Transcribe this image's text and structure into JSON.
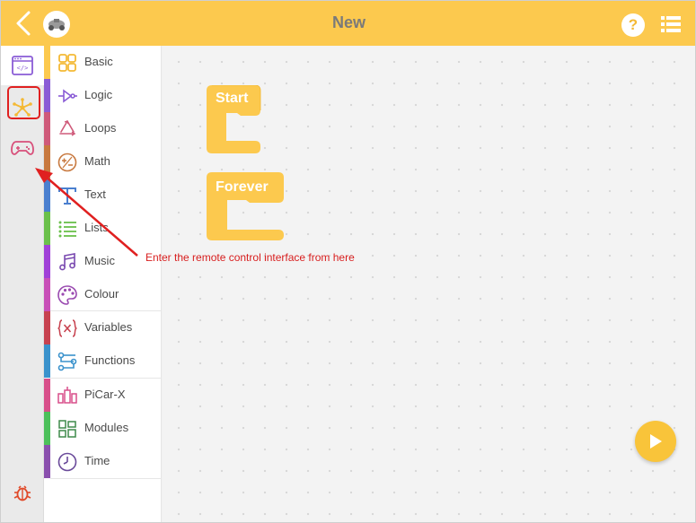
{
  "header": {
    "title": "New",
    "help_label": "?",
    "accent_color": "#fcc94e"
  },
  "rail": {
    "items": [
      {
        "icon": "code-window-icon",
        "active": true
      },
      {
        "icon": "device-hub-icon",
        "active": false
      },
      {
        "icon": "gamepad-icon",
        "active": false,
        "highlighted": true
      },
      {
        "icon": "bug-icon",
        "active": false
      }
    ]
  },
  "categories": [
    {
      "label": "Basic",
      "color": "#fcc94e",
      "icon": "grid-icon"
    },
    {
      "label": "Logic",
      "color": "#8a5cd6",
      "icon": "logic-gate-icon"
    },
    {
      "label": "Loops",
      "color": "#cf5a7a",
      "icon": "recycle-loop-icon"
    },
    {
      "label": "Math",
      "color": "#c8793f",
      "icon": "plus-minus-icon"
    },
    {
      "label": "Text",
      "color": "#4a7fcf",
      "icon": "text-t-icon"
    },
    {
      "label": "Lists",
      "color": "#6ac04a",
      "icon": "list-icon"
    },
    {
      "label": "Music",
      "color": "#a040d8",
      "icon": "music-note-icon"
    },
    {
      "label": "Colour",
      "color": "#c84fb8",
      "icon": "palette-icon"
    },
    {
      "label": "Variables",
      "color": "#c7424f",
      "icon": "variable-x-icon"
    },
    {
      "label": "Functions",
      "color": "#3a92cc",
      "icon": "function-flow-icon"
    },
    {
      "label": "PiCar-X",
      "color": "#d84f8a",
      "icon": "picar-icon"
    },
    {
      "label": "Modules",
      "color": "#4cc05a",
      "icon": "modules-grid-icon"
    },
    {
      "label": "Time",
      "color": "#8a4fae",
      "icon": "clock-icon"
    }
  ],
  "workspace": {
    "blocks": [
      {
        "label": "Start"
      },
      {
        "label": "Forever"
      }
    ],
    "block_color": "#fcc94e"
  },
  "annotation": {
    "text": "Enter the remote control interface from here",
    "color": "#d81e1e"
  }
}
